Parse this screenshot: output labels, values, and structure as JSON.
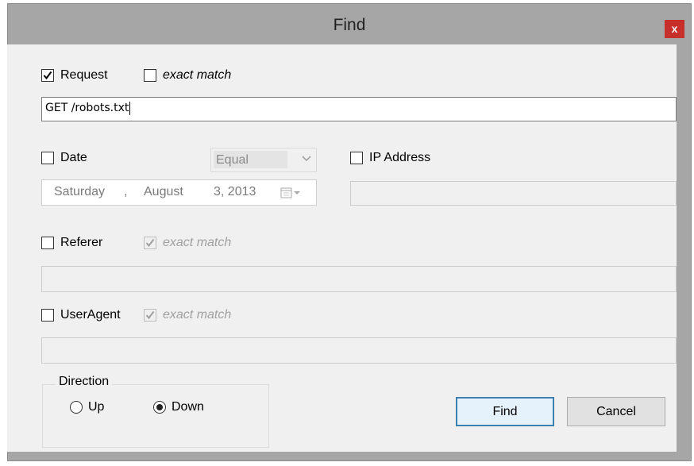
{
  "window": {
    "title": "Find",
    "close_label": "x"
  },
  "request": {
    "checkbox_label": "Request",
    "checked": true,
    "exact_match_label": "exact match",
    "exact_match_checked": false,
    "value": "GET /robots.txt"
  },
  "date": {
    "checkbox_label": "Date",
    "checked": false,
    "operator": "Equal",
    "picker": {
      "day_name": "Saturday",
      "sep": ",",
      "month": "August",
      "day_year": "3, 2013"
    }
  },
  "ip_address": {
    "checkbox_label": "IP Address",
    "checked": false,
    "value": ""
  },
  "referer": {
    "checkbox_label": "Referer",
    "checked": false,
    "exact_match_label": "exact match",
    "exact_match_checked": true,
    "value": ""
  },
  "useragent": {
    "checkbox_label": "UserAgent",
    "checked": false,
    "exact_match_label": "exact match",
    "exact_match_checked": true,
    "value": ""
  },
  "direction": {
    "label": "Direction",
    "up_label": "Up",
    "down_label": "Down",
    "selected": "Down"
  },
  "buttons": {
    "find_label": "Find",
    "cancel_label": "Cancel"
  },
  "colors": {
    "window_frame": "#a6a6a6",
    "client_bg": "#f0f0f0",
    "close_button": "#c7302a",
    "default_button_border": "#3c7fb1"
  }
}
